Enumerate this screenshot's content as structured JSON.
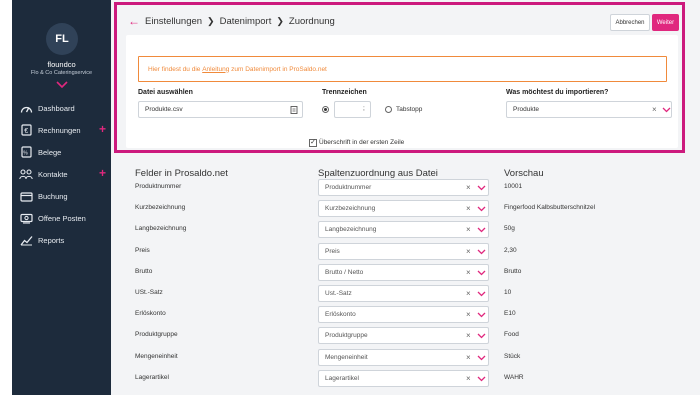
{
  "sidebar": {
    "avatar_initials": "FL",
    "user_name": "floundco",
    "company": "Flo & Co Cateringservice",
    "items": [
      {
        "label": "Dashboard",
        "icon": "dashboard-icon",
        "has_add": false
      },
      {
        "label": "Rechnungen",
        "icon": "invoice-icon",
        "has_add": true
      },
      {
        "label": "Belege",
        "icon": "receipt-icon",
        "has_add": false
      },
      {
        "label": "Kontakte",
        "icon": "contacts-icon",
        "has_add": true
      },
      {
        "label": "Buchung",
        "icon": "booking-icon",
        "has_add": false
      },
      {
        "label": "Offene Posten",
        "icon": "open-items-icon",
        "has_add": false
      },
      {
        "label": "Reports",
        "icon": "reports-icon",
        "has_add": false
      }
    ]
  },
  "header": {
    "breadcrumb": [
      "Einstellungen",
      "Datenimport",
      "Zuordnung"
    ],
    "cancel_label": "Abbrechen",
    "next_label": "Weiter"
  },
  "import_settings": {
    "info_prefix": "Hier findest du die",
    "info_link": "Anleitung",
    "info_suffix": "zum Datenimport in ProSaldo.net",
    "file_label": "Datei auswählen",
    "file_value": "Produkte.csv",
    "separator_label": "Trennzeichen",
    "separator_value": ";",
    "tab_option": "Tabstopp",
    "import_label": "Was möchtest du importieren?",
    "import_value": "Produkte",
    "header_row_label": "Überschrift in der ersten Zeile"
  },
  "mapping": {
    "headers": {
      "fields": "Felder in Prosaldo.net",
      "columns": "Spaltenzuordnung aus Datei",
      "preview": "Vorschau"
    },
    "rows": [
      {
        "field": "Produktnummer",
        "column": "Produktnummer",
        "preview": "10001"
      },
      {
        "field": "Kurzbezeichnung",
        "column": "Kurzbezeichnung",
        "preview": "Fingerfood Kalbsbutterschnitzel"
      },
      {
        "field": "Langbezeichnung",
        "column": "Langbezeichnung",
        "preview": "50g"
      },
      {
        "field": "Preis",
        "column": "Preis",
        "preview": "2,30"
      },
      {
        "field": "Brutto",
        "column": "Brutto / Netto",
        "preview": "Brutto"
      },
      {
        "field": "USt.-Satz",
        "column": "Ust.-Satz",
        "preview": "10"
      },
      {
        "field": "Erlöskonto",
        "column": "Erlöskonto",
        "preview": "E10"
      },
      {
        "field": "Produktgruppe",
        "column": "Produktgruppe",
        "preview": "Food"
      },
      {
        "field": "Mengeneinheit",
        "column": "Mengeneinheit",
        "preview": "Stück"
      },
      {
        "field": "Lagerartikel",
        "column": "Lagerartikel",
        "preview": "WAHR"
      }
    ]
  },
  "colors": {
    "accent": "#e0287e",
    "sidebar": "#1d2b3c",
    "highlight": "#cc1a7d",
    "info": "#f08a3b"
  }
}
